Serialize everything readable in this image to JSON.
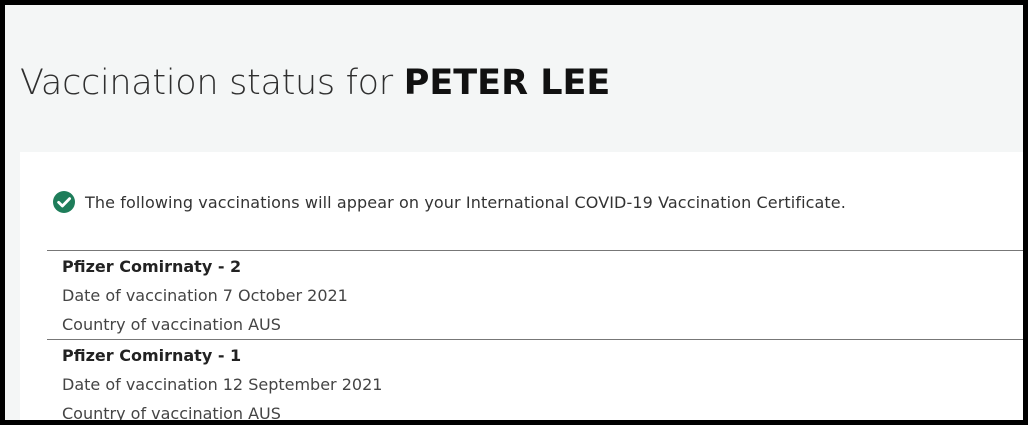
{
  "header": {
    "title_prefix": "Vaccination status for",
    "person_name": "PETER LEE"
  },
  "notice": {
    "icon": "check-circle-icon",
    "icon_color": "#1e7d5a",
    "text": "The following vaccinations will appear on your International COVID-19 Vaccination Certificate."
  },
  "vaccinations": [
    {
      "name": "Pfizer Comirnaty - 2",
      "date_label": "Date of vaccination",
      "date_value": "7 October 2021",
      "country_label": "Country of vaccination",
      "country_value": "AUS"
    },
    {
      "name": "Pfizer Comirnaty - 1",
      "date_label": "Date of vaccination",
      "date_value": "12 September 2021",
      "country_label": "Country of vaccination",
      "country_value": "AUS"
    }
  ]
}
